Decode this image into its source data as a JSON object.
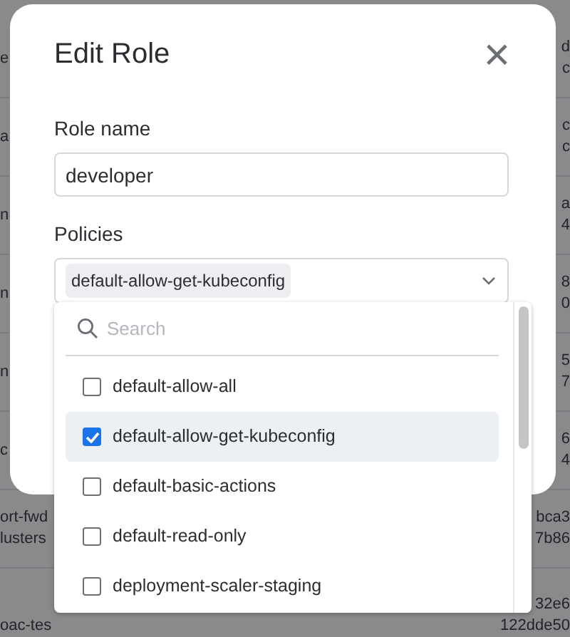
{
  "background_table": {
    "rows": [
      {
        "column_1": [
          "e"
        ],
        "column_2": [
          "d",
          "c"
        ]
      },
      {
        "column_1": [
          "a"
        ],
        "column_2": [
          "c",
          "c"
        ]
      },
      {
        "column_1": [
          "n"
        ],
        "column_2": [
          "a",
          "4"
        ]
      },
      {
        "column_1": [
          "n"
        ],
        "column_2": [
          "8",
          "0"
        ]
      },
      {
        "column_1": [
          "n"
        ],
        "column_2": [
          "5",
          "7"
        ]
      },
      {
        "column_1": [
          "c"
        ],
        "column_2": [
          "6",
          "4"
        ]
      },
      {
        "column_1": [
          "ort-fwd",
          "lusters"
        ],
        "column_2": [
          "bca3",
          "7b86"
        ]
      },
      {
        "column_1": [
          "oac-tes"
        ],
        "column_2": [
          "32e6",
          "122dde50"
        ]
      }
    ]
  },
  "dialog": {
    "title": "Edit Role",
    "close": "×",
    "fields": [
      {
        "label": "Role name",
        "value": "developer"
      }
    ],
    "policies": {
      "label": "Policies",
      "tags": [
        "default-allow-get-kubeconfig"
      ],
      "dropdown": {
        "search_placeholder": "Search",
        "options": [
          {
            "label": "default-allow-all",
            "checked": false,
            "selected": false
          },
          {
            "label": "default-allow-get-kubeconfig",
            "checked": true,
            "selected": true
          },
          {
            "label": "default-basic-actions",
            "checked": false,
            "selected": false
          },
          {
            "label": "default-read-only",
            "checked": false,
            "selected": false
          },
          {
            "label": "deployment-scaler-staging",
            "checked": false,
            "selected": false
          }
        ]
      }
    }
  }
}
